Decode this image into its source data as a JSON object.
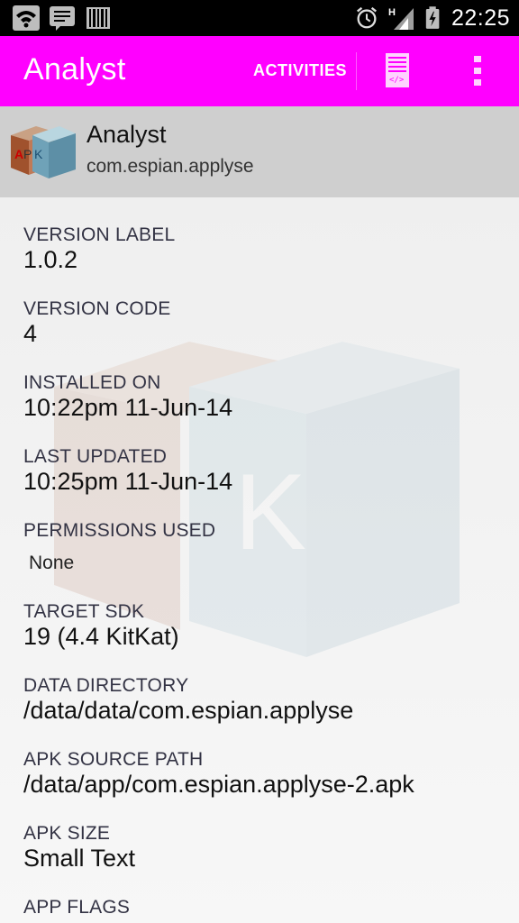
{
  "status_bar": {
    "time": "22:25",
    "left_icons": [
      "wifi-icon",
      "message-icon",
      "barcode-icon"
    ],
    "right_icons": [
      "alarm-icon",
      "signal-icon",
      "battery-icon"
    ],
    "network_type": "H"
  },
  "action_bar": {
    "title": "Analyst",
    "activities_label": "ACTIVITIES",
    "icons": [
      "manifest-doc-icon",
      "overflow-menu-icon"
    ],
    "color": "#ff00ff"
  },
  "app": {
    "name": "Analyst",
    "package": "com.espian.applyse",
    "icon": "apk-cube-icon",
    "icon_text": "APK"
  },
  "details": [
    {
      "label": "VERSION LABEL",
      "value": "1.0.2"
    },
    {
      "label": "VERSION CODE",
      "value": "4"
    },
    {
      "label": "INSTALLED ON",
      "value": "10:22pm 11-Jun-14"
    },
    {
      "label": "LAST UPDATED",
      "value": "10:25pm 11-Jun-14"
    },
    {
      "label": "PERMISSIONS USED",
      "value": "None"
    },
    {
      "label": "TARGET SDK",
      "value": "19 (4.4 KitKat)"
    },
    {
      "label": "DATA DIRECTORY",
      "value": "/data/data/com.espian.applyse"
    },
    {
      "label": "APK SOURCE PATH",
      "value": "/data/app/com.espian.applyse-2.apk"
    },
    {
      "label": "APK SIZE",
      "value": "Small Text"
    },
    {
      "label": "APP FLAGS",
      "value": ""
    }
  ]
}
